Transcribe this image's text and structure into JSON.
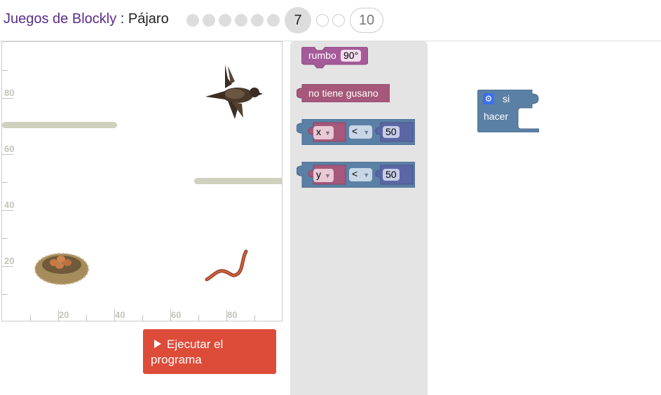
{
  "header": {
    "app_title": "Juegos de Blockly",
    "separator": " : ",
    "level_name": "Pájaro",
    "current_level": "7",
    "last_level": "10",
    "completed_dots": 6,
    "future_dots": 2
  },
  "play_area": {
    "y_axis_labels": [
      "80",
      "60",
      "40",
      "20"
    ],
    "x_axis_labels": [
      "20",
      "40",
      "60",
      "80"
    ],
    "sprites": {
      "bird": "bird-icon",
      "nest": "nest-icon",
      "worm": "worm-icon"
    }
  },
  "run_button": {
    "label": "Ejecutar el programa",
    "icon": "play-icon"
  },
  "toolbox": {
    "heading_block": {
      "label": "rumbo",
      "value": "90°",
      "color": "#a55b99"
    },
    "no_worm_block": {
      "label": "no tiene gusano",
      "color": "#a5587a"
    },
    "compare_x": {
      "var": "x",
      "op": "<",
      "value": "50",
      "color": "#5b80a5"
    },
    "compare_y": {
      "var": "y",
      "op": "<",
      "value": "50",
      "color": "#5b80a5"
    }
  },
  "workspace": {
    "if_block": {
      "if_label": "si",
      "do_label": "hacer",
      "color": "#5b80a5",
      "icon": "gear-icon"
    }
  }
}
